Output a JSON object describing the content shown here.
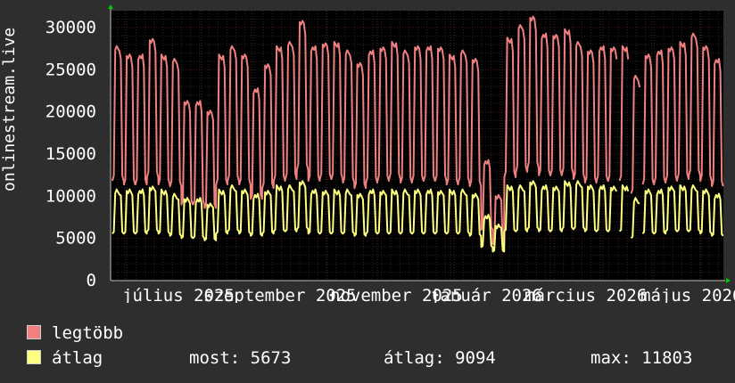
{
  "chart_data": {
    "type": "line",
    "ylabel": "onlinestream.live",
    "ylim": [
      0,
      32000
    ],
    "grid": true,
    "y_ticks": [
      0,
      5000,
      10000,
      15000,
      20000,
      25000,
      30000
    ],
    "y_tick_labels": [
      "0",
      "5000",
      "10000",
      "15000",
      "20000",
      "25000",
      "30000"
    ],
    "x_tick_labels": [
      "július 2025",
      "szeptember 2025",
      "november 2025",
      "január 2026",
      "március 2026",
      "május 2026"
    ],
    "x_label_anchor": [
      "július 2025",
      "szeptember 2025",
      "november 2025",
      "január 2026",
      "március 2026",
      "május 2026"
    ],
    "series": [
      {
        "name": "legtöbb",
        "color": "#f08080",
        "weekly_high": [
          27500,
          26500,
          26500,
          28500,
          26500,
          26000,
          21000,
          21000,
          20000,
          26500,
          27500,
          26500,
          22500,
          25500,
          27500,
          28000,
          30500,
          27500,
          28000,
          28000,
          27000,
          25500,
          27000,
          27500,
          28000,
          27000,
          27500,
          27500,
          27500,
          26500,
          27000,
          26000,
          14000,
          10000,
          28500,
          30000,
          31000,
          29000,
          29000,
          29500,
          28000,
          27000,
          27500,
          27500,
          27500,
          24000,
          26500,
          27000,
          27500,
          28000,
          29000,
          27500,
          26000
        ]
      },
      {
        "name": "átlag",
        "color": "#ffff80",
        "weekly_high": [
          10500,
          10500,
          10500,
          11000,
          10500,
          10000,
          9500,
          9500,
          9000,
          10500,
          11000,
          10500,
          10000,
          10500,
          11000,
          11000,
          11500,
          10500,
          10500,
          10500,
          10500,
          10000,
          10500,
          10500,
          10500,
          10500,
          10500,
          10500,
          10500,
          10500,
          10500,
          10000,
          7500,
          6500,
          11000,
          11000,
          11500,
          11000,
          11000,
          11500,
          11500,
          11000,
          11000,
          11000,
          11000,
          9500,
          10500,
          10500,
          11000,
          11000,
          11000,
          10500,
          10000
        ]
      }
    ]
  },
  "legend": {
    "max_label": "legtöbb",
    "avg_label": "átlag",
    "max_color": "#f08080",
    "avg_color": "#ffff80"
  },
  "stats": {
    "now": "most: 5673",
    "avg": "átlag: 9094",
    "max": "max: 11803"
  }
}
